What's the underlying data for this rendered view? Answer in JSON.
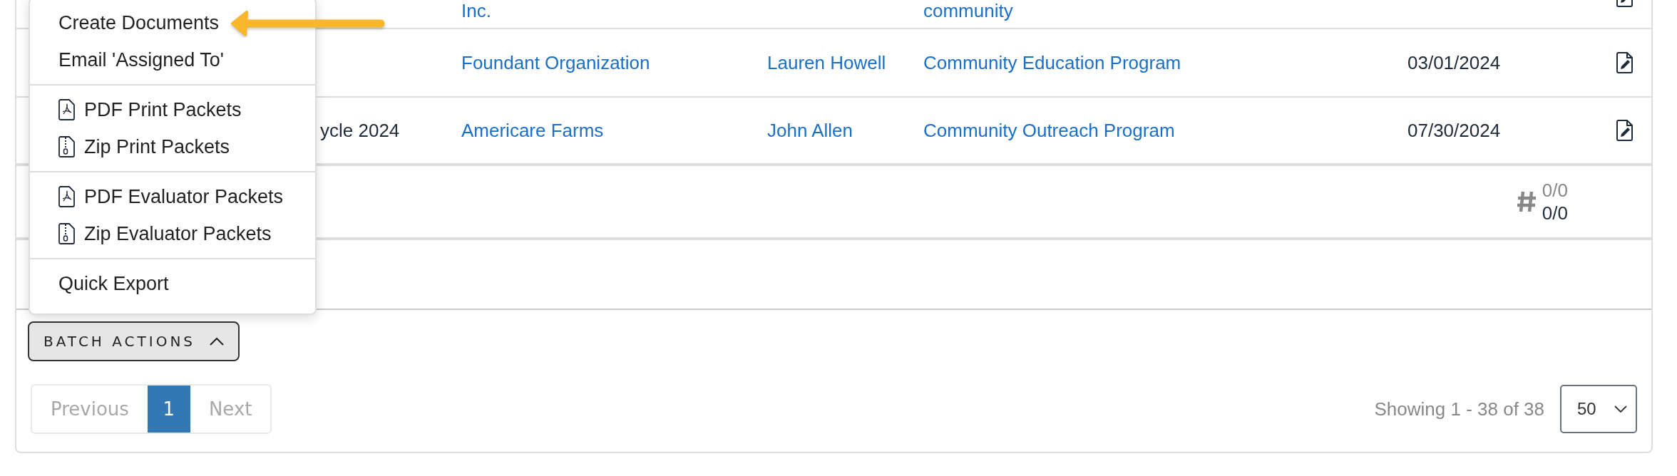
{
  "table": {
    "rows": [
      {
        "kind": "partial",
        "column_2": "Inc.",
        "column_4": "community"
      },
      {
        "kind": "full",
        "column_2": "Foundant Organization",
        "column_3": "Lauren Howell",
        "column_4": "Community Education Program",
        "column_5": "03/01/2024"
      },
      {
        "kind": "full",
        "column_1": "ycle 2024",
        "column_2": "Americare Farms",
        "column_3": "John Allen",
        "column_4": "Community Outreach Program",
        "column_5": "07/30/2024"
      }
    ],
    "summary": {
      "count_top": "0/0",
      "count_bottom": "0/0"
    }
  },
  "batch_actions": {
    "label": "BATCH ACTIONS",
    "expanded": true,
    "menu": [
      [
        {
          "label": "Create Documents",
          "kind": "plain"
        },
        {
          "label": "Email 'Assigned To'",
          "kind": "plain"
        }
      ],
      [
        {
          "label": "PDF Print Packets",
          "kind": "pdf"
        },
        {
          "label": "Zip Print Packets",
          "kind": "zip"
        }
      ],
      [
        {
          "label": "PDF Evaluator Packets",
          "kind": "pdf"
        },
        {
          "label": "Zip Evaluator Packets",
          "kind": "zip"
        }
      ],
      [
        {
          "label": "Quick Export",
          "kind": "plain"
        }
      ]
    ]
  },
  "pagination": {
    "previous": {
      "label": "Previous",
      "disabled": true
    },
    "pages": [
      {
        "label": "1",
        "selected": true
      }
    ],
    "next": {
      "label": "Next",
      "disabled": true
    }
  },
  "status": "Showing 1 - 38 of 38",
  "page_size": "50"
}
